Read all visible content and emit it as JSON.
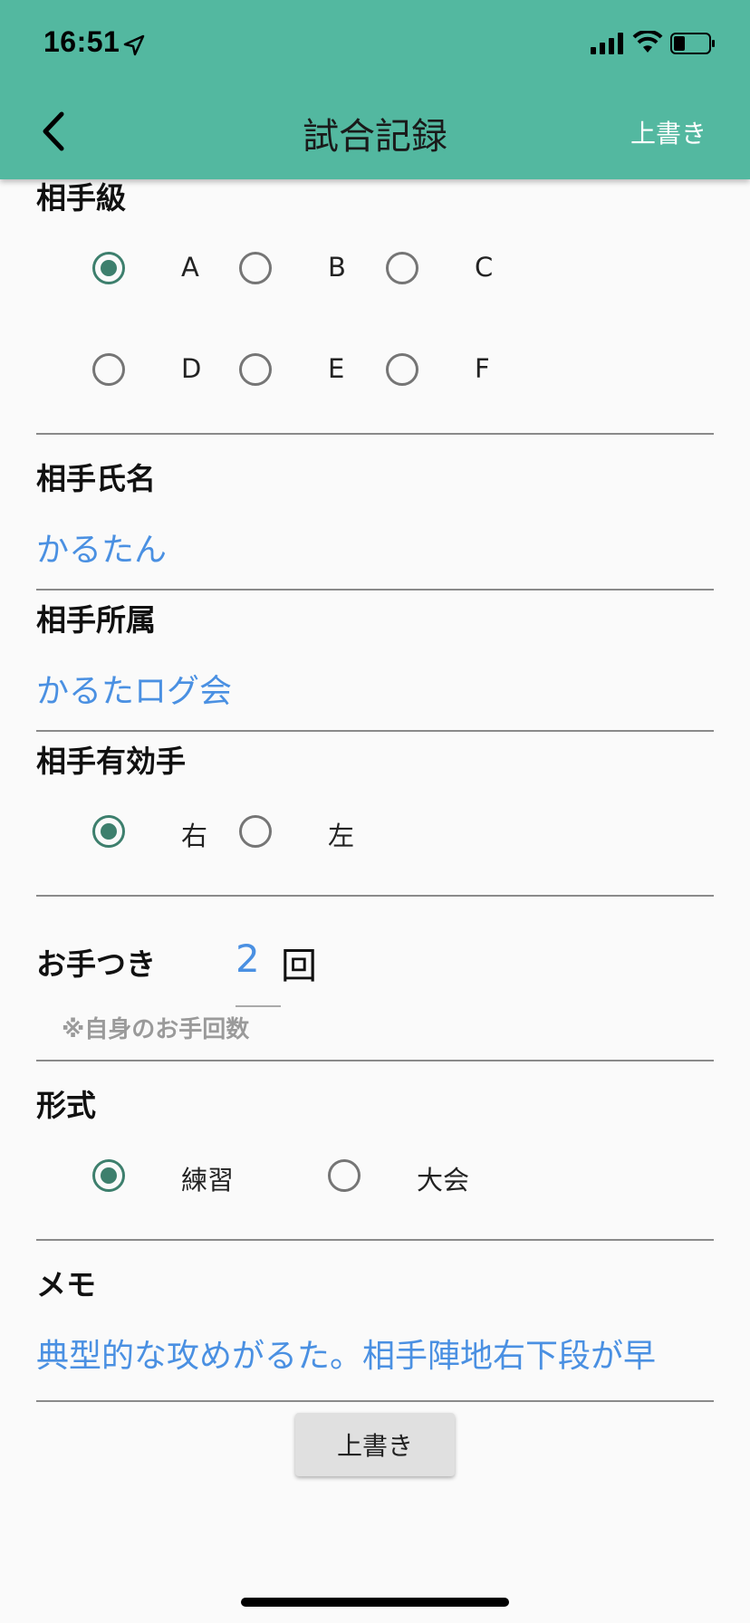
{
  "status_bar": {
    "time": "16:51"
  },
  "header": {
    "title": "試合記録",
    "overwrite_label": "上書き"
  },
  "opponent_rank": {
    "label": "相手級",
    "options": [
      "A",
      "B",
      "C",
      "D",
      "E",
      "F"
    ],
    "selected": "A"
  },
  "opponent_name": {
    "label": "相手氏名",
    "value": "かるたん"
  },
  "opponent_affiliation": {
    "label": "相手所属",
    "value": "かるたログ会"
  },
  "opponent_hand": {
    "label": "相手有効手",
    "options": [
      "右",
      "左"
    ],
    "selected": "右"
  },
  "otetsuki": {
    "label": "お手つき",
    "count": "2",
    "unit": "回",
    "note": "※自身のお手回数"
  },
  "format": {
    "label": "形式",
    "options": [
      "練習",
      "大会"
    ],
    "selected": "練習"
  },
  "memo": {
    "label": "メモ",
    "value": "典型的な攻めがるた。相手陣地右下段が早"
  },
  "save_button": {
    "label": "上書き"
  },
  "colors": {
    "appbar": "#53b8a0",
    "accent_radio": "#3d7f6d",
    "input_text": "#4a90e2"
  }
}
